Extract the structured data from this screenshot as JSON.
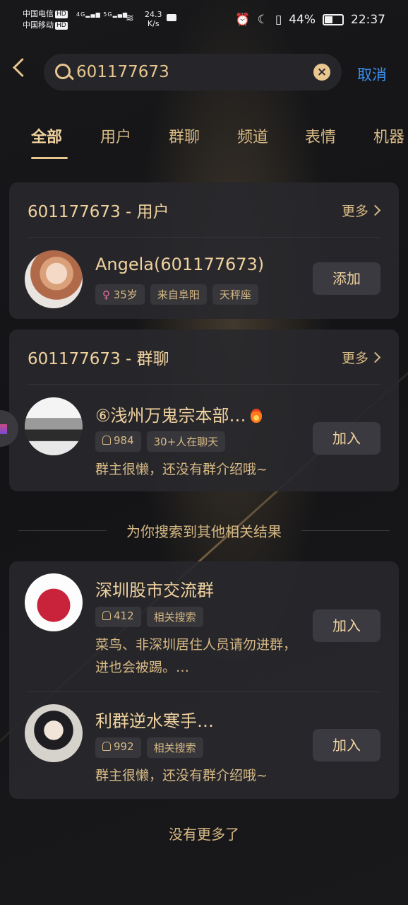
{
  "status_bar": {
    "carrier1": "中国电信",
    "carrier2": "中国移动",
    "hd": "HD",
    "net_speed": "24.3",
    "net_unit": "K/s",
    "battery": "44%",
    "time": "22:37"
  },
  "search": {
    "query": "601177673",
    "cancel_label": "取消"
  },
  "tabs": [
    "全部",
    "用户",
    "群聊",
    "频道",
    "表情",
    "机器"
  ],
  "user_section": {
    "title": "601177673 - 用户",
    "more": "更多",
    "user": {
      "name": "Angela(601177673)",
      "gender_age": "35岁",
      "location": "来自阜阳",
      "zodiac": "天秤座",
      "action": "添加"
    }
  },
  "group_section": {
    "title": "601177673 - 群聊",
    "more": "更多",
    "group": {
      "name": "⑥浅州万鬼宗本部…",
      "members": "984",
      "active": "30+人在聊天",
      "desc": "群主很懒，还没有群介绍哦~",
      "action": "加入"
    }
  },
  "related": {
    "heading": "为你搜索到其他相关结果",
    "items": [
      {
        "name": "深圳股市交流群",
        "members": "412",
        "tag": "相关搜索",
        "desc": "菜鸟、非深圳居住人员请勿进群，进也会被踢。…",
        "action": "加入"
      },
      {
        "name": "利群逆水寒手…",
        "members": "992",
        "tag": "相关搜索",
        "desc": "群主很懒，还没有群介绍哦~",
        "action": "加入"
      }
    ]
  },
  "footer": {
    "no_more": "没有更多了"
  },
  "colors": {
    "accent_gold": "#e8c690",
    "cancel_blue": "#3b8ff0",
    "background": "#141416"
  }
}
